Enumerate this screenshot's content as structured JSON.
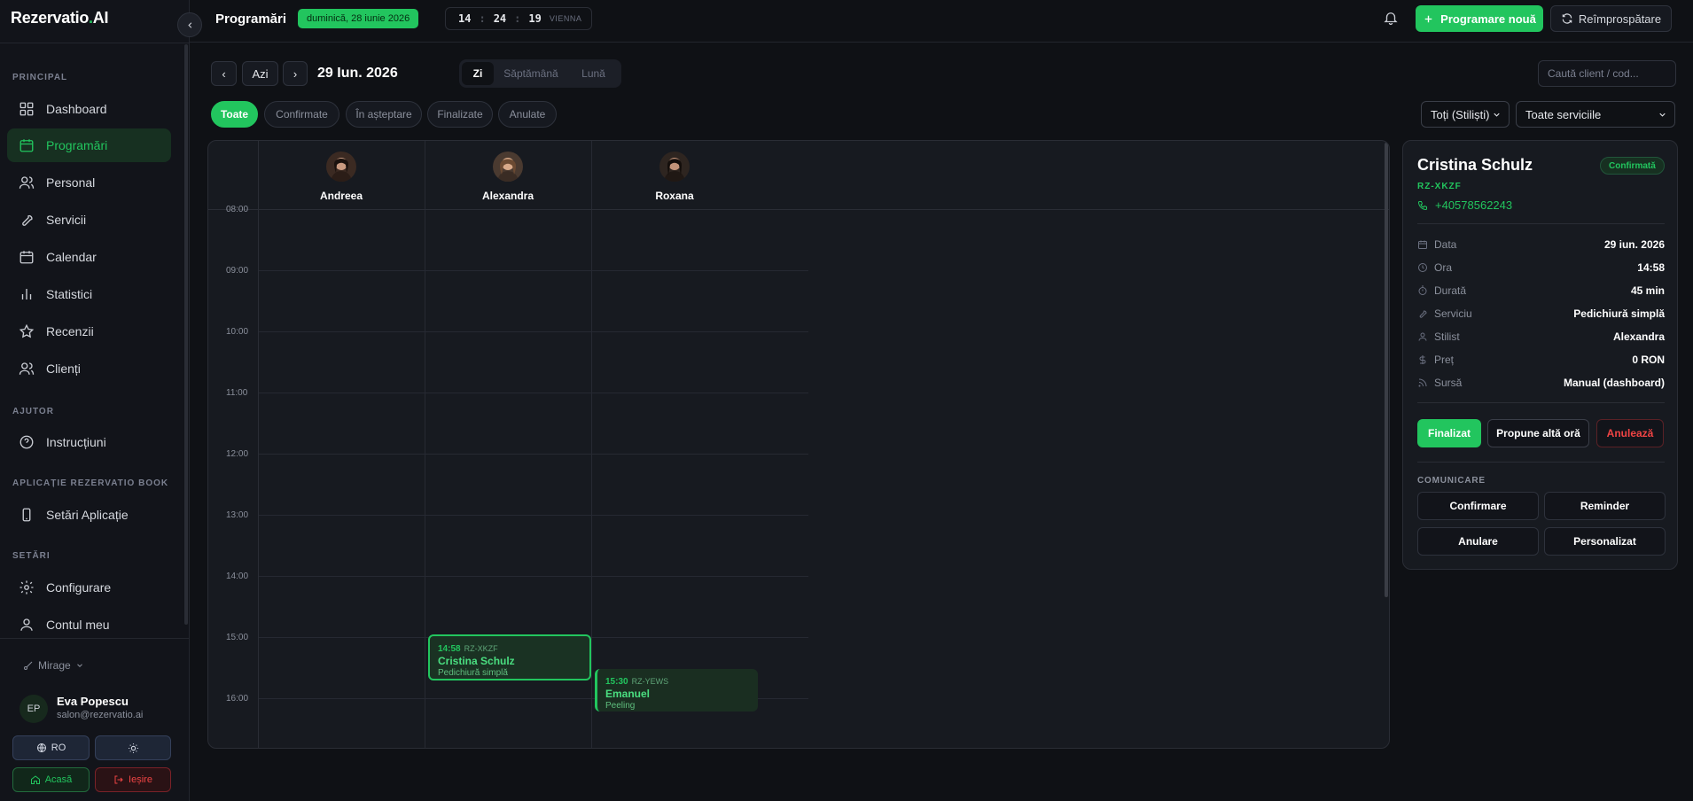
{
  "app": {
    "brand_main": "Rezervatio",
    "brand_dot": ".",
    "brand_ai": "AI"
  },
  "sidebar": {
    "sections": [
      "PRINCIPAL",
      "AJUTOR",
      "APLICAȚIE REZERVATIO BOOK",
      "SETĂRI"
    ],
    "items": [
      {
        "label": "Dashboard",
        "icon": "dashboard-icon"
      },
      {
        "label": "Programări",
        "icon": "calendar-icon"
      },
      {
        "label": "Personal",
        "icon": "users-icon"
      },
      {
        "label": "Servicii",
        "icon": "wrench-icon"
      },
      {
        "label": "Calendar",
        "icon": "calendar-icon"
      },
      {
        "label": "Statistici",
        "icon": "bar-chart-icon"
      },
      {
        "label": "Recenzii",
        "icon": "star-icon"
      },
      {
        "label": "Clienți",
        "icon": "users-icon"
      },
      {
        "label": "Instrucțiuni",
        "icon": "help-icon"
      },
      {
        "label": "Setări Aplicație",
        "icon": "phone-icon"
      },
      {
        "label": "Configurare",
        "icon": "gear-icon"
      },
      {
        "label": "Contul meu",
        "icon": "user-icon"
      }
    ],
    "active_item": "Programări",
    "salon": "Mirage",
    "user": {
      "initials": "EP",
      "name": "Eva Popescu",
      "email": "salon@rezervatio.ai"
    },
    "lang_label": "RO",
    "home_label": "Acasă",
    "exit_label": "Ieșire"
  },
  "topbar": {
    "title": "Programări",
    "date_badge": "duminică, 28 iunie 2026",
    "clock": {
      "h": "14",
      "m": "24",
      "s": "19",
      "tz": "VIENNA"
    },
    "new_label": "Programare nouă",
    "refresh_label": "Reîmprospătare"
  },
  "controls": {
    "prev": "‹",
    "today": "Azi",
    "next": "›",
    "current_date": "29 Iun. 2026",
    "views": [
      "Zi",
      "Săptămână",
      "Lună"
    ],
    "active_view": "Zi",
    "search_placeholder": "Caută client / cod...",
    "filters": [
      "Toate",
      "Confirmate",
      "În așteptare",
      "Finalizate",
      "Anulate"
    ],
    "active_filter": "Toate",
    "stylist_select": "Toți (Stiliști)",
    "service_select": "Toate serviciile"
  },
  "calendar": {
    "staff": [
      "Andreea",
      "Alexandra",
      "Roxana"
    ],
    "hours": [
      "08:00",
      "09:00",
      "10:00",
      "11:00",
      "12:00",
      "13:00",
      "14:00",
      "15:00",
      "16:00"
    ],
    "appointments": [
      {
        "time": "14:58",
        "code": "RZ-XKZF",
        "name": "Cristina Schulz",
        "service": "Pedichiură simplă",
        "staff": "Alexandra",
        "selected": true
      },
      {
        "time": "15:30",
        "code": "RZ-YEWS",
        "name": "Emanuel",
        "service": "Peeling",
        "staff": "Roxana",
        "selected": false
      }
    ]
  },
  "details": {
    "name": "Cristina Schulz",
    "status": "Confirmată",
    "code": "RZ-XKZF",
    "phone": "+40578562243",
    "rows": [
      {
        "label": "Data",
        "value": "29 iun. 2026",
        "icon": "calendar-icon"
      },
      {
        "label": "Ora",
        "value": "14:58",
        "icon": "clock-icon"
      },
      {
        "label": "Durată",
        "value": "45 min",
        "icon": "timer-icon"
      },
      {
        "label": "Serviciu",
        "value": "Pedichiură simplă",
        "icon": "wrench-icon"
      },
      {
        "label": "Stilist",
        "value": "Alexandra",
        "icon": "user-icon"
      },
      {
        "label": "Preț",
        "value": "0 RON",
        "icon": "dollar-icon"
      },
      {
        "label": "Sursă",
        "value": "Manual (dashboard)",
        "icon": "rss-icon"
      }
    ],
    "actions": {
      "finalize": "Finalizat",
      "propose": "Propune altă oră",
      "cancel": "Anulează"
    },
    "comm_title": "COMUNICARE",
    "comm": [
      "Confirmare",
      "Reminder",
      "Anulare",
      "Personalizat"
    ]
  },
  "colors": {
    "accent": "#22c55e",
    "background": "#0f1115",
    "danger": "#ef4444"
  }
}
